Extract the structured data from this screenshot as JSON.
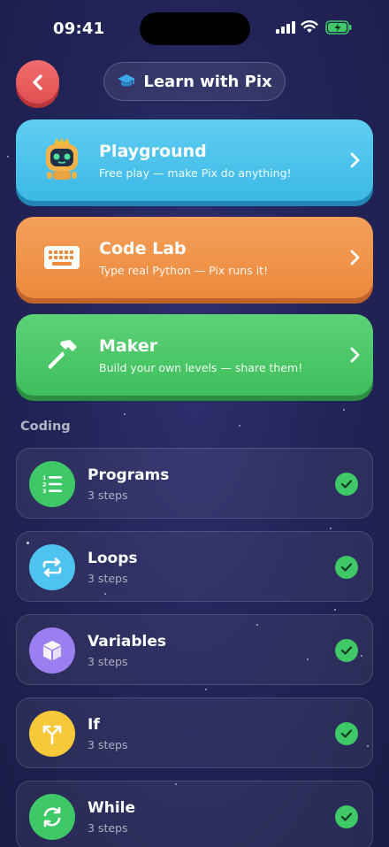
{
  "status_bar": {
    "time": "09:41"
  },
  "header": {
    "title": "Learn with Pix",
    "back_icon": "chevron-left-icon",
    "title_icon": "graduation-cap-icon"
  },
  "modes": [
    {
      "title": "Playground",
      "subtitle": "Free play — make Pix do anything!",
      "icon": "robot-icon",
      "color": "#4cc3ec"
    },
    {
      "title": "Code Lab",
      "subtitle": "Type real Python — Pix runs it!",
      "icon": "keyboard-icon",
      "color": "#f0954a"
    },
    {
      "title": "Maker",
      "subtitle": "Build your own levels — share them!",
      "icon": "hammer-icon",
      "color": "#4cc869"
    }
  ],
  "section": {
    "label": "Coding"
  },
  "lessons": [
    {
      "title": "Programs",
      "subtitle": "3 steps",
      "icon": "numbered-list-icon",
      "color": "#3ec868",
      "completed": true
    },
    {
      "title": "Loops",
      "subtitle": "3 steps",
      "icon": "repeat-arrows-icon",
      "color": "#4fc3f0",
      "completed": true
    },
    {
      "title": "Variables",
      "subtitle": "3 steps",
      "icon": "box-icon",
      "color": "#9b7ff0",
      "completed": true
    },
    {
      "title": "If",
      "subtitle": "3 steps",
      "icon": "branch-icon",
      "color": "#f5c93a",
      "completed": true
    },
    {
      "title": "While",
      "subtitle": "3 steps",
      "icon": "cycle-icon",
      "color": "#3ec868",
      "completed": true
    }
  ]
}
